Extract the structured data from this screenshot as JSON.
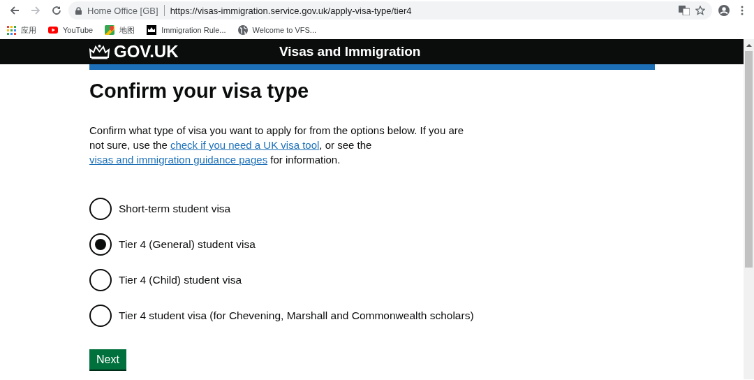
{
  "browser": {
    "site_name": "Home Office [GB]",
    "url": "https://visas-immigration.service.gov.uk/apply-visa-type/tier4",
    "bookmarks": [
      {
        "kind": "apps",
        "label": "应用"
      },
      {
        "kind": "youtube",
        "label": "YouTube"
      },
      {
        "kind": "maps",
        "label": "地图"
      },
      {
        "kind": "crown",
        "label": "Immigration Rule..."
      },
      {
        "kind": "globe",
        "label": "Welcome to VFS..."
      }
    ]
  },
  "header": {
    "logo": "GOV.UK",
    "service": "Visas and Immigration"
  },
  "heading": "Confirm your visa type",
  "intro": [
    {
      "kind": "text",
      "text": "Confirm what type of visa you want to apply for from the options below. If you are not sure, use the "
    },
    {
      "kind": "link",
      "text": "check if you need a UK visa tool"
    },
    {
      "kind": "text",
      "text": ", or see the "
    },
    {
      "kind": "link",
      "text": "visas and immigration guidance pages"
    },
    {
      "kind": "text",
      "text": " for information."
    }
  ],
  "options": [
    {
      "label": "Short-term student visa",
      "selected": false
    },
    {
      "label": "Tier 4 (General) student visa",
      "selected": true
    },
    {
      "label": "Tier 4 (Child) student visa",
      "selected": false
    },
    {
      "label": "Tier 4 student visa (for Chevening, Marshall and Commonwealth scholars)",
      "selected": false
    }
  ],
  "next_button": "Next"
}
